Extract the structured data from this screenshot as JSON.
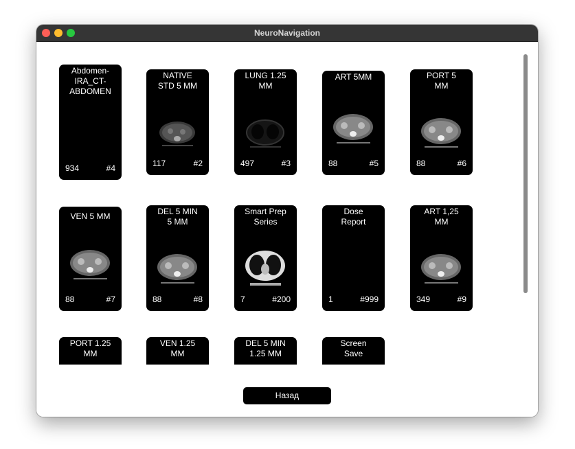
{
  "window": {
    "title": "NeuroNavigation"
  },
  "tiles": [
    {
      "label": "Abdomen-\nIRA_CT-\nABDOMEN",
      "count": "934",
      "num": "#4"
    },
    {
      "label": "NATIVE\nSTD 5 MM",
      "count": "117",
      "num": "#2"
    },
    {
      "label": "LUNG 1.25\nMM",
      "count": "497",
      "num": "#3"
    },
    {
      "label": "ART 5MM",
      "count": "88",
      "num": "#5"
    },
    {
      "label": "PORT  5\nMM",
      "count": "88",
      "num": "#6"
    },
    {
      "label": "VEN 5  MM",
      "count": "88",
      "num": "#7"
    },
    {
      "label": "DEL 5 MIN\n5 MM",
      "count": "88",
      "num": "#8"
    },
    {
      "label": "Smart Prep\nSeries",
      "count": "7",
      "num": "#200"
    },
    {
      "label": "Dose\nReport",
      "count": "1",
      "num": "#999"
    },
    {
      "label": "ART 1,25\nMM",
      "count": "349",
      "num": "#9"
    },
    {
      "label": "PORT 1.25\nMM"
    },
    {
      "label": "VEN 1.25\nMM"
    },
    {
      "label": "DEL  5 MIN\n1.25 MM"
    },
    {
      "label": "Screen\nSave"
    }
  ],
  "back_button": {
    "label": "Назад"
  }
}
